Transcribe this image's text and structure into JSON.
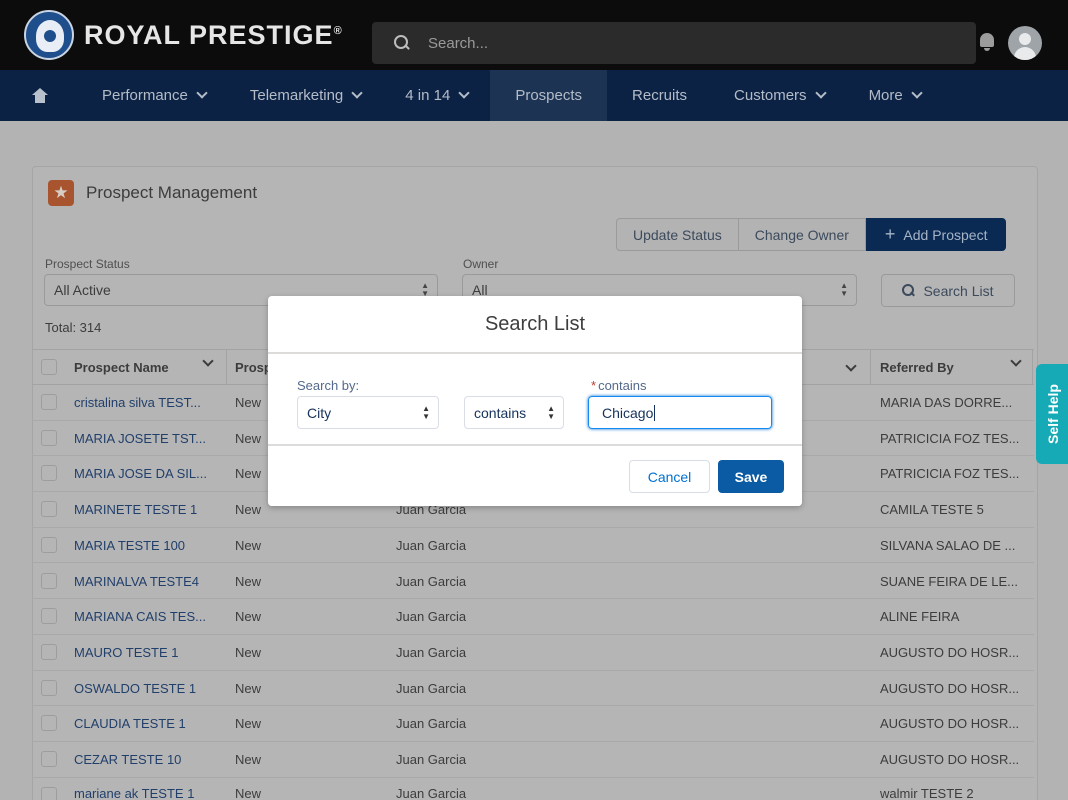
{
  "header": {
    "brand": "ROYAL PRESTIGE",
    "brand_mark": "®",
    "search_placeholder": "Search..."
  },
  "nav": {
    "items": [
      {
        "label": "Performance",
        "dropdown": true
      },
      {
        "label": "Telemarketing",
        "dropdown": true
      },
      {
        "label": "4 in 14",
        "dropdown": true
      },
      {
        "label": "Prospects",
        "dropdown": false,
        "active": true
      },
      {
        "label": "Recruits",
        "dropdown": false
      },
      {
        "label": "Customers",
        "dropdown": true
      },
      {
        "label": "More",
        "dropdown": true
      }
    ]
  },
  "page": {
    "title": "Prospect Management",
    "icon": "★",
    "buttons": {
      "update_status": "Update Status",
      "change_owner": "Change Owner",
      "add_prospect": "Add Prospect",
      "search_list": "Search List"
    },
    "filters": {
      "status_label": "Prospect Status",
      "status_value": "All Active",
      "owner_label": "Owner",
      "owner_value": "All"
    },
    "total": "Total: 314"
  },
  "table": {
    "columns": [
      "Prospect Name",
      "Prosp",
      "Referred By"
    ],
    "rows": [
      {
        "name": "cristalina silva TEST...",
        "status": "New",
        "owner": "",
        "referred": "MARIA DAS DORRE..."
      },
      {
        "name": "MARIA JOSETE TST...",
        "status": "New",
        "owner": "",
        "referred": "PATRICICIA FOZ TES..."
      },
      {
        "name": "MARIA JOSE DA SIL...",
        "status": "New",
        "owner": "",
        "referred": "PATRICICIA FOZ TES..."
      },
      {
        "name": "MARINETE TESTE 1",
        "status": "New",
        "owner": "Juan Garcia",
        "referred": "CAMILA TESTE 5"
      },
      {
        "name": "MARIA TESTE 100",
        "status": "New",
        "owner": "Juan Garcia",
        "referred": "SILVANA SALAO DE ..."
      },
      {
        "name": "MARINALVA TESTE4",
        "status": "New",
        "owner": "Juan Garcia",
        "referred": "SUANE FEIRA DE LE..."
      },
      {
        "name": "MARIANA CAIS TES...",
        "status": "New",
        "owner": "Juan Garcia",
        "referred": "ALINE FEIRA"
      },
      {
        "name": "MAURO TESTE 1",
        "status": "New",
        "owner": "Juan Garcia",
        "referred": "AUGUSTO DO HOSR..."
      },
      {
        "name": "OSWALDO TESTE 1",
        "status": "New",
        "owner": "Juan Garcia",
        "referred": "AUGUSTO DO HOSR..."
      },
      {
        "name": "CLAUDIA TESTE 1",
        "status": "New",
        "owner": "Juan Garcia",
        "referred": "AUGUSTO DO HOSR..."
      },
      {
        "name": "CEZAR TESTE 10",
        "status": "New",
        "owner": "Juan Garcia",
        "referred": "AUGUSTO DO HOSR..."
      },
      {
        "name": "mariane ak TESTE 1",
        "status": "New",
        "owner": "Juan Garcia",
        "referred": "walmir TESTE 2"
      }
    ]
  },
  "self_help": "Self Help",
  "modal": {
    "title": "Search List",
    "search_by_label": "Search by:",
    "search_by_value": "City",
    "operator_value": "contains",
    "value_label": "contains",
    "value": "Chicago",
    "cancel": "Cancel",
    "save": "Save"
  },
  "colors": {
    "nav_bg": "#0c2244",
    "primary": "#0a5ba3",
    "link": "#0070d2",
    "self_help": "#15aab5"
  }
}
